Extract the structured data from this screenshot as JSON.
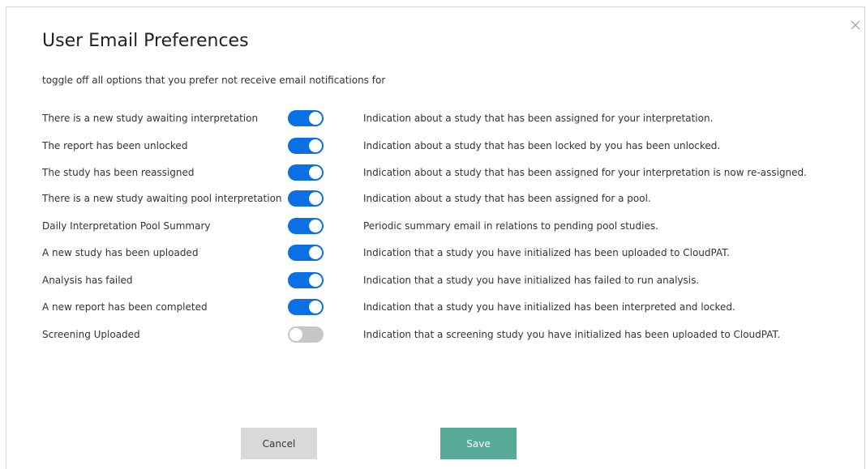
{
  "dialog": {
    "title": "User Email Preferences",
    "subtitle": "toggle off all options that you prefer not receive email notifications for",
    "close_icon": "close-icon"
  },
  "colors": {
    "toggle_on": "#0b70e6",
    "toggle_off": "#c6c6c6",
    "save_button": "#57a999",
    "cancel_button": "#d9d9d9"
  },
  "preferences": [
    {
      "label": "There is a new study awaiting interpretation",
      "enabled": true,
      "description": "Indication about a study that has been assigned for your interpretation."
    },
    {
      "label": "The report has been unlocked",
      "enabled": true,
      "description": "Indication about a study that has been locked by you has been unlocked."
    },
    {
      "label": "The study has been reassigned",
      "enabled": true,
      "description": "Indication about a study that has been assigned for your interpretation is now re-assigned."
    },
    {
      "label": "There is a new study awaiting pool interpretation",
      "enabled": true,
      "description": "Indication about a study that has been assigned for a pool."
    },
    {
      "label": "Daily Interpretation Pool Summary",
      "enabled": true,
      "description": "Periodic summary email in relations to pending pool studies."
    },
    {
      "label": "A new study has been uploaded",
      "enabled": true,
      "description": "Indication that a study you have initialized has been uploaded to CloudPAT."
    },
    {
      "label": "Analysis has failed",
      "enabled": true,
      "description": "Indication that a study you have initialized has failed to run analysis."
    },
    {
      "label": "A new report has been completed",
      "enabled": true,
      "description": "Indication that a study you have initialized has been interpreted and locked."
    },
    {
      "label": "Screening Uploaded",
      "enabled": false,
      "description": "Indication that a screening study you have initialized has been uploaded to CloudPAT."
    }
  ],
  "buttons": {
    "cancel_label": "Cancel",
    "save_label": "Save"
  }
}
